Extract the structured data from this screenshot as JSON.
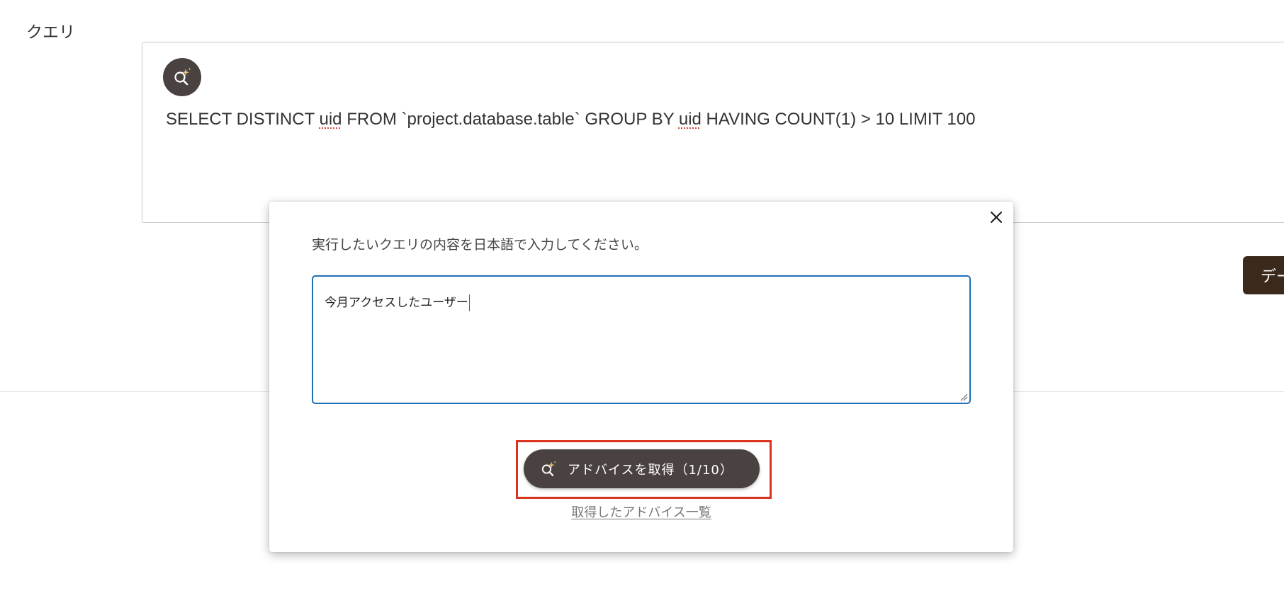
{
  "query_section": {
    "label": "クエリ",
    "query_parts": {
      "p1": "SELECT DISTINCT ",
      "p2": "uid",
      "p3": " FROM `project.database.table` GROUP BY ",
      "p4": "uid",
      "p5": " HAVING COUNT(1) > 10 LIMIT 100"
    }
  },
  "right_button": {
    "label": "デー"
  },
  "modal": {
    "instruction": "実行したいクエリの内容を日本語で入力してください。",
    "input_value": "今月アクセスしたユーザー",
    "advice_button": "アドバイスを取得（1/10）",
    "advice_list_link": "取得したアドバイス一覧"
  },
  "colors": {
    "accent_dark": "#4a4240",
    "input_border": "#1f6fb3",
    "highlight": "#d9341f",
    "icon_gold": "#e8c07a"
  },
  "icons": [
    "ai-search-sparkle-icon",
    "close-icon",
    "resize-grip-icon"
  ]
}
